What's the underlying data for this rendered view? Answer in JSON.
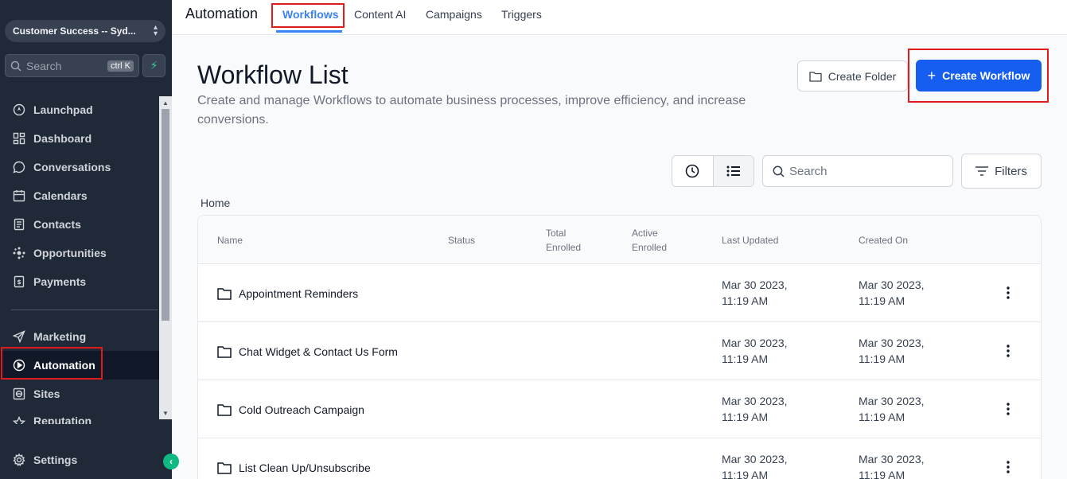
{
  "sidebar": {
    "account_name": "Customer Success -- Syd...",
    "search_placeholder": "Search",
    "search_shortcut": "ctrl K",
    "items": [
      {
        "label": "Launchpad",
        "icon": "rocket-icon"
      },
      {
        "label": "Dashboard",
        "icon": "grid-icon"
      },
      {
        "label": "Conversations",
        "icon": "chat-icon"
      },
      {
        "label": "Calendars",
        "icon": "calendar-icon"
      },
      {
        "label": "Contacts",
        "icon": "contacts-icon"
      },
      {
        "label": "Opportunities",
        "icon": "network-icon"
      },
      {
        "label": "Payments",
        "icon": "receipt-icon"
      }
    ],
    "items2": [
      {
        "label": "Marketing",
        "icon": "send-icon"
      },
      {
        "label": "Automation",
        "icon": "play-circle-icon",
        "active": true
      },
      {
        "label": "Sites",
        "icon": "globe-icon"
      },
      {
        "label": "Reputation",
        "icon": "star-icon"
      }
    ],
    "settings_label": "Settings"
  },
  "topbar": {
    "title": "Automation",
    "tabs": [
      "Workflows",
      "Content AI",
      "Campaigns",
      "Triggers"
    ],
    "active_tab": "Workflows"
  },
  "main": {
    "title": "Workflow List",
    "description": "Create and manage Workflows to automate business processes, improve efficiency, and increase conversions.",
    "create_folder_label": "Create Folder",
    "create_workflow_label": "Create Workflow",
    "search_placeholder": "Search",
    "filters_label": "Filters",
    "breadcrumb": "Home"
  },
  "table": {
    "columns": {
      "name": "Name",
      "status": "Status",
      "total_enrolled": [
        "Total",
        "Enrolled"
      ],
      "active_enrolled": [
        "Active",
        "Enrolled"
      ],
      "last_updated": "Last Updated",
      "created_on": "Created On"
    },
    "rows": [
      {
        "name": "Appointment Reminders",
        "updated": [
          "Mar 30 2023,",
          "11:19 AM"
        ],
        "created": [
          "Mar 30 2023,",
          "11:19 AM"
        ]
      },
      {
        "name": "Chat Widget & Contact Us Form",
        "updated": [
          "Mar 30 2023,",
          "11:19 AM"
        ],
        "created": [
          "Mar 30 2023,",
          "11:19 AM"
        ]
      },
      {
        "name": "Cold Outreach Campaign",
        "updated": [
          "Mar 30 2023,",
          "11:19 AM"
        ],
        "created": [
          "Mar 30 2023,",
          "11:19 AM"
        ]
      },
      {
        "name": "List Clean Up/Unsubscribe",
        "updated": [
          "Mar 30 2023,",
          "11:19 AM"
        ],
        "created": [
          "Mar 30 2023,",
          "11:19 AM"
        ]
      }
    ]
  },
  "colors": {
    "sidebar_bg": "#1f2937",
    "accent": "#155eef",
    "tab_active": "#3b82f6",
    "highlight": "#e01b1b"
  }
}
